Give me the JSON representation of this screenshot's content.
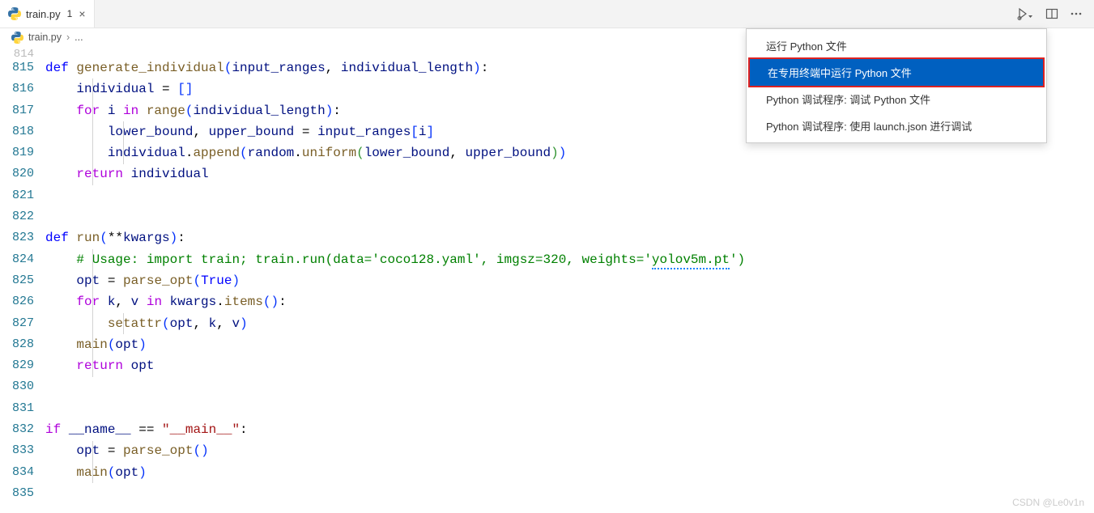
{
  "tab": {
    "filename": "train.py",
    "modified_indicator": "1",
    "close_glyph": "×"
  },
  "breadcrumb": {
    "filename": "train.py",
    "chevron": "›",
    "ellipsis": "..."
  },
  "menu": {
    "items": [
      {
        "label": "运行 Python 文件",
        "selected": false
      },
      {
        "label": "在专用终端中运行 Python 文件",
        "selected": true
      },
      {
        "label": "Python 调试程序: 调试 Python 文件",
        "selected": false
      },
      {
        "label": "Python 调试程序: 使用 launch.json 进行调试",
        "selected": false
      }
    ]
  },
  "editor": {
    "faded_line": "814",
    "lines": [
      {
        "num": "815",
        "tokens": [
          [
            "k-def",
            "def "
          ],
          [
            "k-fn",
            "generate_individual"
          ],
          [
            "k-br1",
            "("
          ],
          [
            "k-var",
            "input_ranges"
          ],
          [
            "k-punc",
            ", "
          ],
          [
            "k-var",
            "individual_length"
          ],
          [
            "k-br1",
            ")"
          ],
          [
            "k-punc",
            ":"
          ]
        ]
      },
      {
        "num": "816",
        "indent": 1,
        "tokens": [
          [
            "k-var",
            "individual"
          ],
          [
            "k-op",
            " = "
          ],
          [
            "k-br1",
            "["
          ],
          [
            "k-br1",
            "]"
          ]
        ]
      },
      {
        "num": "817",
        "indent": 1,
        "tokens": [
          [
            "k-ctrl",
            "for "
          ],
          [
            "k-var",
            "i"
          ],
          [
            "k-ctrl",
            " in "
          ],
          [
            "k-fn",
            "range"
          ],
          [
            "k-br1",
            "("
          ],
          [
            "k-var",
            "individual_length"
          ],
          [
            "k-br1",
            ")"
          ],
          [
            "k-punc",
            ":"
          ]
        ]
      },
      {
        "num": "818",
        "indent": 2,
        "tokens": [
          [
            "k-var",
            "lower_bound"
          ],
          [
            "k-punc",
            ", "
          ],
          [
            "k-var",
            "upper_bound"
          ],
          [
            "k-op",
            " = "
          ],
          [
            "k-var",
            "input_ranges"
          ],
          [
            "k-br1",
            "["
          ],
          [
            "k-var",
            "i"
          ],
          [
            "k-br1",
            "]"
          ]
        ]
      },
      {
        "num": "819",
        "indent": 2,
        "tokens": [
          [
            "k-var",
            "individual"
          ],
          [
            "k-punc",
            "."
          ],
          [
            "k-fn",
            "append"
          ],
          [
            "k-br1",
            "("
          ],
          [
            "k-var",
            "random"
          ],
          [
            "k-punc",
            "."
          ],
          [
            "k-fn",
            "uniform"
          ],
          [
            "k-br2",
            "("
          ],
          [
            "k-var",
            "lower_bound"
          ],
          [
            "k-punc",
            ", "
          ],
          [
            "k-var",
            "upper_bound"
          ],
          [
            "k-br2",
            ")"
          ],
          [
            "k-br1",
            ")"
          ]
        ]
      },
      {
        "num": "820",
        "indent": 1,
        "tokens": [
          [
            "k-ctrl",
            "return "
          ],
          [
            "k-var",
            "individual"
          ]
        ]
      },
      {
        "num": "821",
        "tokens": []
      },
      {
        "num": "822",
        "tokens": []
      },
      {
        "num": "823",
        "tokens": [
          [
            "k-def",
            "def "
          ],
          [
            "k-fn",
            "run"
          ],
          [
            "k-br1",
            "("
          ],
          [
            "k-op",
            "**"
          ],
          [
            "k-var",
            "kwargs"
          ],
          [
            "k-br1",
            ")"
          ],
          [
            "k-punc",
            ":"
          ]
        ]
      },
      {
        "num": "824",
        "indent": 1,
        "tokens": [
          [
            "k-cmt",
            "# Usage: import train; train.run(data='coco128.yaml', imgsz=320, weights='"
          ],
          [
            "k-cmt",
            "yolov5m.pt"
          ],
          [
            "k-cmt",
            "')"
          ]
        ]
      },
      {
        "num": "825",
        "indent": 1,
        "tokens": [
          [
            "k-var",
            "opt"
          ],
          [
            "k-op",
            " = "
          ],
          [
            "k-fn",
            "parse_opt"
          ],
          [
            "k-br1",
            "("
          ],
          [
            "k-bool",
            "True"
          ],
          [
            "k-br1",
            ")"
          ]
        ]
      },
      {
        "num": "826",
        "indent": 1,
        "tokens": [
          [
            "k-ctrl",
            "for "
          ],
          [
            "k-var",
            "k"
          ],
          [
            "k-punc",
            ", "
          ],
          [
            "k-var",
            "v"
          ],
          [
            "k-ctrl",
            " in "
          ],
          [
            "k-var",
            "kwargs"
          ],
          [
            "k-punc",
            "."
          ],
          [
            "k-fn",
            "items"
          ],
          [
            "k-br1",
            "("
          ],
          [
            "k-br1",
            ")"
          ],
          [
            "k-punc",
            ":"
          ]
        ]
      },
      {
        "num": "827",
        "indent": 2,
        "tokens": [
          [
            "k-fn",
            "setattr"
          ],
          [
            "k-br1",
            "("
          ],
          [
            "k-var",
            "opt"
          ],
          [
            "k-punc",
            ", "
          ],
          [
            "k-var",
            "k"
          ],
          [
            "k-punc",
            ", "
          ],
          [
            "k-var",
            "v"
          ],
          [
            "k-br1",
            ")"
          ]
        ]
      },
      {
        "num": "828",
        "indent": 1,
        "tokens": [
          [
            "k-fn",
            "main"
          ],
          [
            "k-br1",
            "("
          ],
          [
            "k-var",
            "opt"
          ],
          [
            "k-br1",
            ")"
          ]
        ]
      },
      {
        "num": "829",
        "indent": 1,
        "tokens": [
          [
            "k-ctrl",
            "return "
          ],
          [
            "k-var",
            "opt"
          ]
        ]
      },
      {
        "num": "830",
        "tokens": []
      },
      {
        "num": "831",
        "tokens": []
      },
      {
        "num": "832",
        "tokens": [
          [
            "k-ctrl",
            "if "
          ],
          [
            "k-var",
            "__name__"
          ],
          [
            "k-op",
            " == "
          ],
          [
            "k-str",
            "\"__main__\""
          ],
          [
            "k-punc",
            ":"
          ]
        ]
      },
      {
        "num": "833",
        "indent": 1,
        "tokens": [
          [
            "k-var",
            "opt"
          ],
          [
            "k-op",
            " = "
          ],
          [
            "k-fn",
            "parse_opt"
          ],
          [
            "k-br1",
            "("
          ],
          [
            "k-br1",
            ")"
          ]
        ]
      },
      {
        "num": "834",
        "indent": 1,
        "tokens": [
          [
            "k-fn",
            "main"
          ],
          [
            "k-br1",
            "("
          ],
          [
            "k-var",
            "opt"
          ],
          [
            "k-br1",
            ")"
          ]
        ]
      },
      {
        "num": "835",
        "tokens": []
      }
    ]
  },
  "watermark": "CSDN @Le0v1n",
  "colors": {
    "selection_bg": "#0060c0",
    "selection_border": "#d22"
  }
}
